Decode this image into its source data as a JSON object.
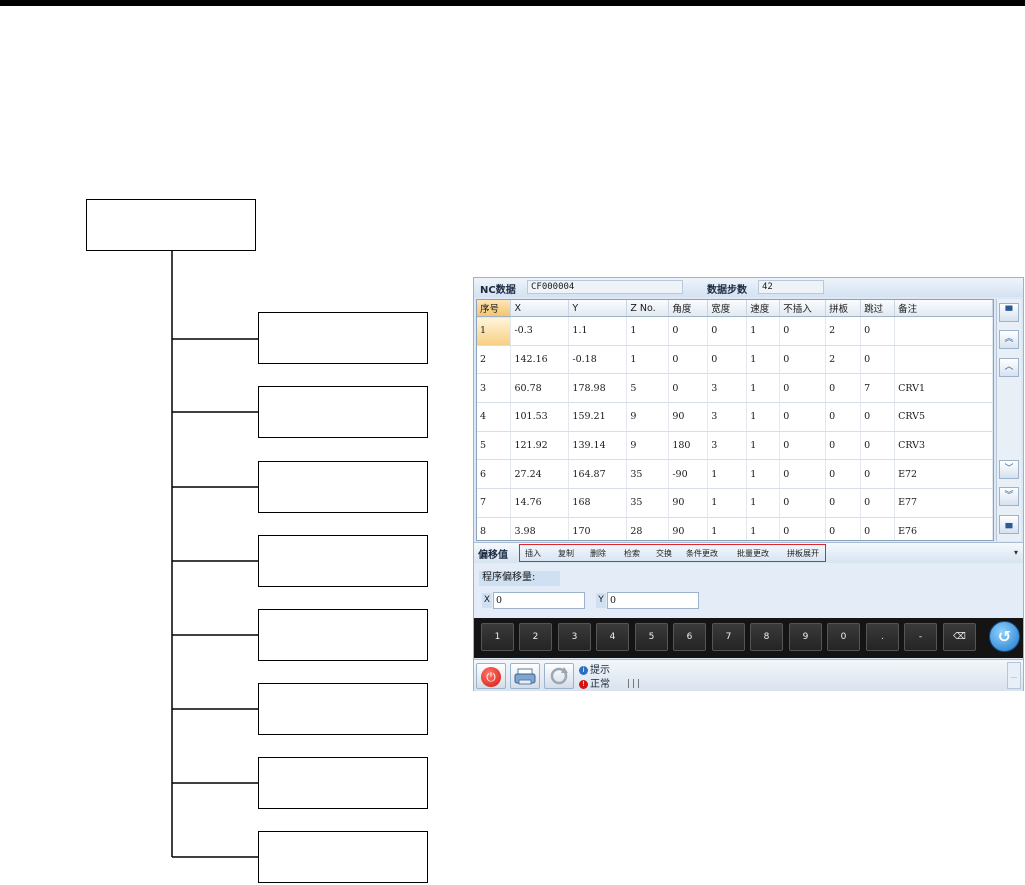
{
  "header": {
    "nc_label": "NC数据",
    "nc_value": "CF000004",
    "steps_label": "数据步数",
    "steps_value": "42"
  },
  "table": {
    "columns": [
      "序号",
      "X",
      "Y",
      "Z No.",
      "角度",
      "宽度",
      "速度",
      "不插入",
      "拼板",
      "跳过",
      "备注"
    ],
    "rows": [
      [
        "1",
        "-0.3",
        "1.1",
        "1",
        "0",
        "0",
        "1",
        "0",
        "2",
        "0",
        ""
      ],
      [
        "2",
        "142.16",
        "-0.18",
        "1",
        "0",
        "0",
        "1",
        "0",
        "2",
        "0",
        ""
      ],
      [
        "3",
        "60.78",
        "178.98",
        "5",
        "0",
        "3",
        "1",
        "0",
        "0",
        "7",
        "CRV1"
      ],
      [
        "4",
        "101.53",
        "159.21",
        "9",
        "90",
        "3",
        "1",
        "0",
        "0",
        "0",
        "CRV5"
      ],
      [
        "5",
        "121.92",
        "139.14",
        "9",
        "180",
        "3",
        "1",
        "0",
        "0",
        "0",
        "CRV3"
      ],
      [
        "6",
        "27.24",
        "164.87",
        "35",
        "-90",
        "1",
        "1",
        "0",
        "0",
        "0",
        "E72"
      ],
      [
        "7",
        "14.76",
        "168",
        "35",
        "90",
        "1",
        "1",
        "0",
        "0",
        "0",
        "E77"
      ],
      [
        "8",
        "3.98",
        "170",
        "28",
        "90",
        "1",
        "1",
        "0",
        "0",
        "0",
        "E76"
      ]
    ]
  },
  "side_buttons": [
    "top-icon",
    "page-up-icon",
    "line-up-icon",
    "line-down-icon",
    "page-down-icon",
    "bottom-icon"
  ],
  "tabs": {
    "active": "偏移值",
    "items": [
      "插入",
      "复制",
      "删除",
      "检索",
      "交换",
      "条件更改",
      "批量更改",
      "拼板展开"
    ],
    "dropdown": "▾"
  },
  "offset": {
    "label": "程序偏移量:",
    "x_label": "X",
    "x_value": "0",
    "y_label": "Y",
    "y_value": "0"
  },
  "keyboard": {
    "keys": [
      "1",
      "2",
      "3",
      "4",
      "5",
      "6",
      "7",
      "8",
      "9",
      "0",
      ".",
      "-"
    ],
    "backspace": "⌫"
  },
  "status": {
    "hint": "提示",
    "normal": "正常",
    "bars": "|||"
  },
  "colors": {
    "highlight_box": "#e0262a",
    "accent": "#1f78c8",
    "power": "#d4140f"
  }
}
